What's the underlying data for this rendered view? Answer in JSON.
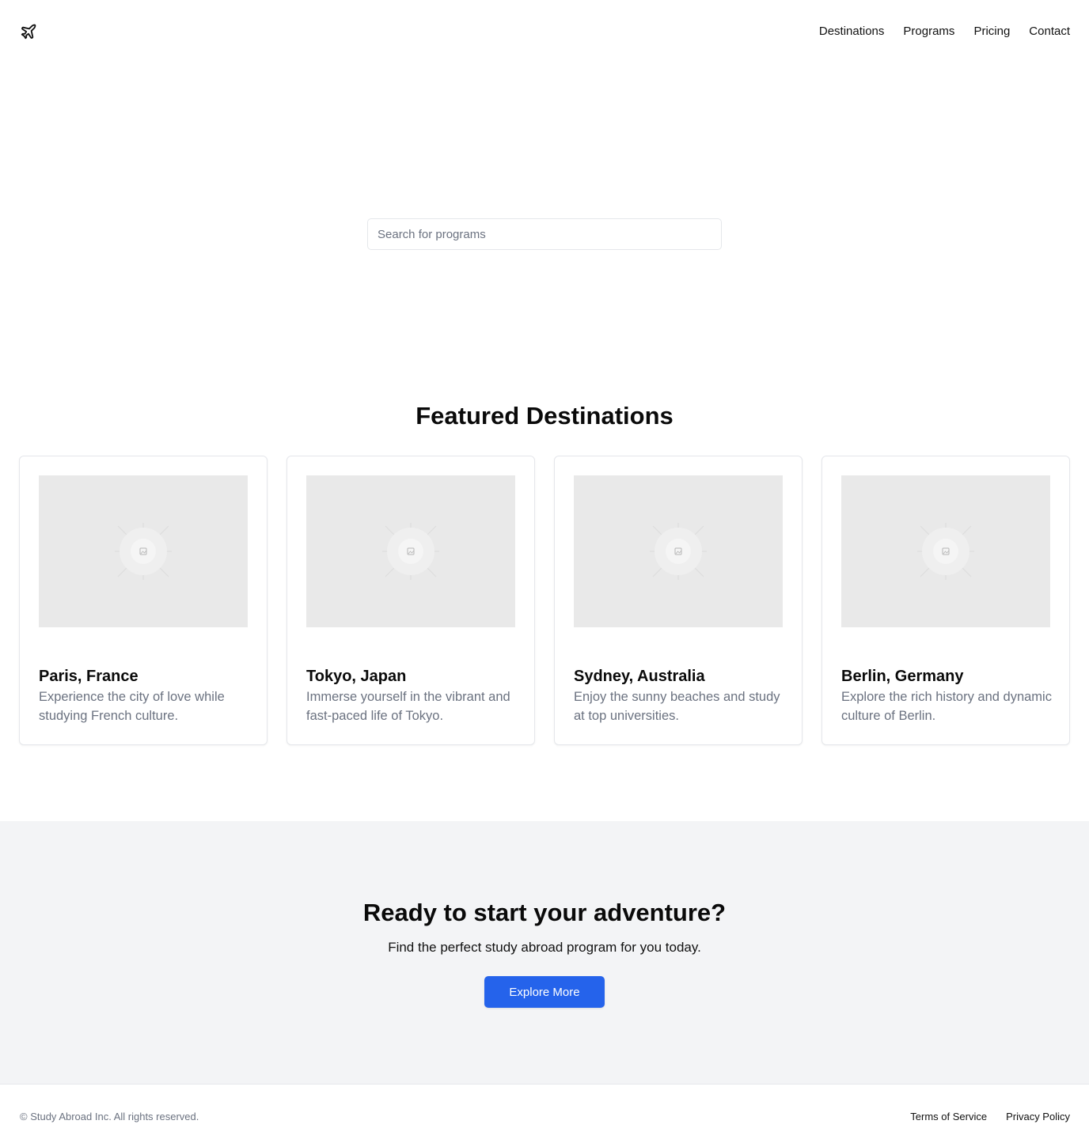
{
  "header": {
    "logo_icon": "airplane-icon",
    "nav": [
      {
        "label": "Destinations"
      },
      {
        "label": "Programs"
      },
      {
        "label": "Pricing"
      },
      {
        "label": "Contact"
      }
    ]
  },
  "search": {
    "placeholder": "Search for programs",
    "value": ""
  },
  "featured": {
    "title": "Featured Destinations",
    "cards": [
      {
        "title": "Paris, France",
        "description": "Experience the city of love while studying French culture.",
        "image_icon": "image-placeholder-icon"
      },
      {
        "title": "Tokyo, Japan",
        "description": "Immerse yourself in the vibrant and fast-paced life of Tokyo.",
        "image_icon": "image-placeholder-icon"
      },
      {
        "title": "Sydney, Australia",
        "description": "Enjoy the sunny beaches and study at top universities.",
        "image_icon": "image-placeholder-icon"
      },
      {
        "title": "Berlin, Germany",
        "description": "Explore the rich history and dynamic culture of Berlin.",
        "image_icon": "image-placeholder-icon"
      }
    ]
  },
  "cta": {
    "title": "Ready to start your adventure?",
    "subtitle": "Find the perfect study abroad program for you today.",
    "button_label": "Explore More"
  },
  "footer": {
    "copyright": "© Study Abroad Inc. All rights reserved.",
    "links": [
      {
        "label": "Terms of Service"
      },
      {
        "label": "Privacy Policy"
      }
    ]
  },
  "colors": {
    "accent": "#2563eb",
    "muted_text": "#6b7280",
    "cta_background": "#f3f4f6",
    "border": "#e5e7eb"
  }
}
